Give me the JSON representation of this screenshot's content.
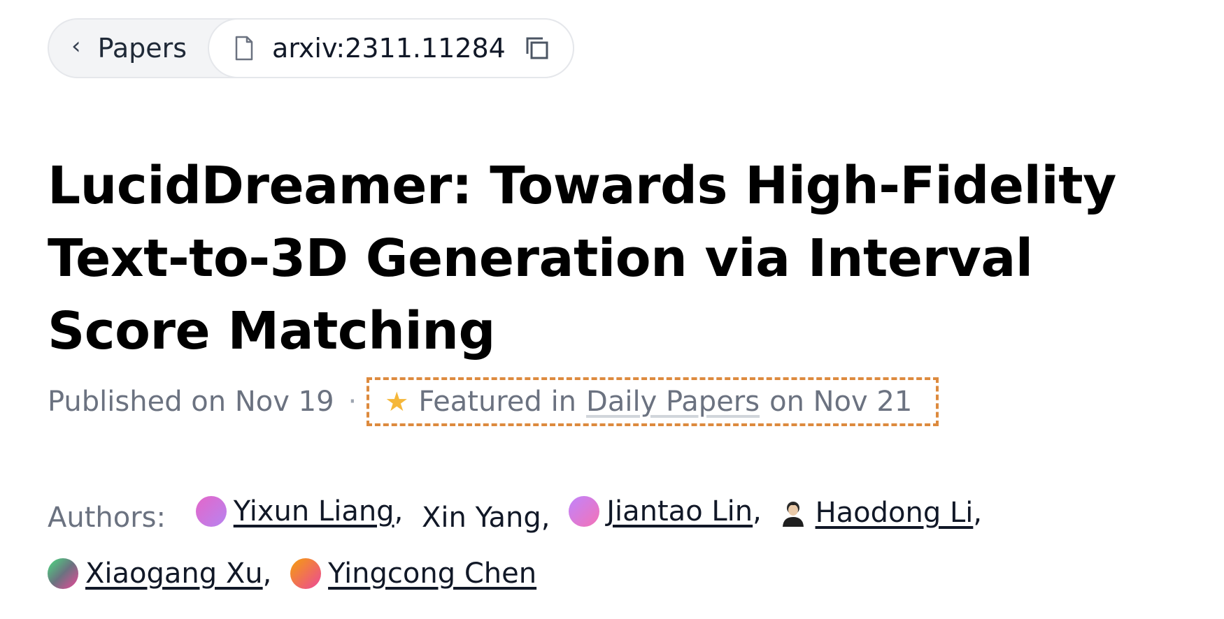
{
  "breadcrumb": {
    "back_icon": "chevron-left-icon",
    "back_label": "Papers",
    "paper_icon": "document-icon",
    "paper_id": "arxiv:2311.11284",
    "copy_icon": "copy-icon"
  },
  "paper": {
    "title": "LucidDreamer: Towards High-Fidelity Text-to-3D Generation via Interval Score Matching",
    "published": "Published on Nov 19",
    "featured": {
      "icon": "star-icon",
      "prefix": "Featured in",
      "link": "Daily Papers",
      "suffix": "on Nov 21"
    }
  },
  "authors": {
    "label": "Authors:",
    "list": [
      {
        "name": "Yixun Liang",
        "avatar": "gradient",
        "colors": [
          "#e466c9",
          "#b784f0"
        ]
      },
      {
        "name": "Xin Yang",
        "avatar": "none"
      },
      {
        "name": "Jiantao Lin",
        "avatar": "gradient",
        "colors": [
          "#c084fc",
          "#f472b6"
        ]
      },
      {
        "name": "Haodong Li",
        "avatar": "photo"
      },
      {
        "name": "Xiaogang Xu",
        "avatar": "gradient",
        "colors": [
          "#4ade80",
          "#ec4899"
        ]
      },
      {
        "name": "Yingcong Chen",
        "avatar": "gradient",
        "colors": [
          "#f59e0b",
          "#ec4899"
        ]
      }
    ]
  },
  "colors": {
    "highlight_border": "#dd8a3e",
    "star": "#f5b73a",
    "muted_text": "#6b7280"
  }
}
